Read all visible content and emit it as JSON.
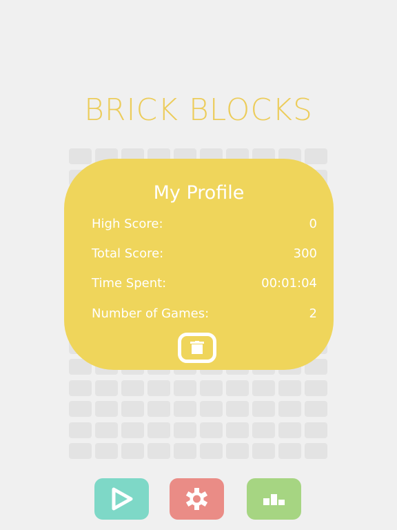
{
  "app": {
    "title": "BRICK BLOCKS"
  },
  "profile": {
    "title": "My Profile",
    "stats": [
      {
        "label": "High Score:",
        "value": "0"
      },
      {
        "label": "Total Score:",
        "value": "300"
      },
      {
        "label": "Time Spent:",
        "value": "00:01:04"
      },
      {
        "label": "Number of Games:",
        "value": "2"
      }
    ],
    "delete_icon": "trash-icon"
  },
  "board": {
    "columns": 10,
    "rows": 15
  },
  "toolbar": {
    "buttons": [
      {
        "name": "play-button",
        "icon": "play-icon",
        "color": "#7ed8c7"
      },
      {
        "name": "settings-button",
        "icon": "gear-icon",
        "color": "#ea8c86"
      },
      {
        "name": "leaderboard-button",
        "icon": "podium-icon",
        "color": "#a6d582"
      }
    ]
  },
  "colors": {
    "background": "#f0f0f0",
    "accent_yellow": "#efd55b",
    "title_yellow": "#eccc5a",
    "empty_cell": "#e3e3e3"
  }
}
